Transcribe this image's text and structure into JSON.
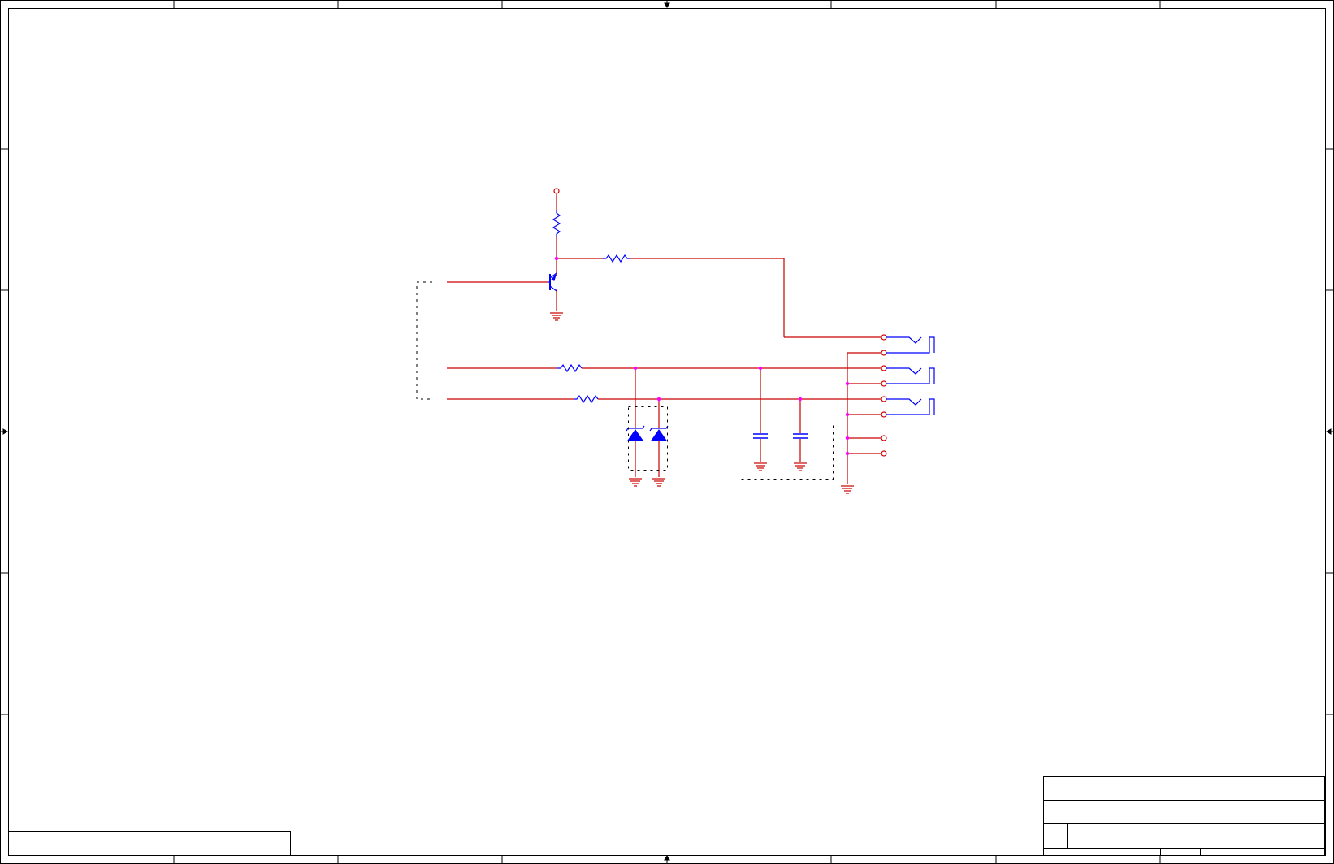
{
  "app": {
    "title": ""
  },
  "schematic": {
    "colors": {
      "wire": "#cc0000",
      "component": "#0000ff",
      "junction": "#ff00ff",
      "frame": "#000000",
      "background": "#ffffff",
      "port": "#cc0000"
    },
    "title_block": {
      "title": "",
      "size": "",
      "document_number": "",
      "revision": "",
      "date": "",
      "sheet": ""
    },
    "revision_block": {
      "text": ""
    }
  }
}
